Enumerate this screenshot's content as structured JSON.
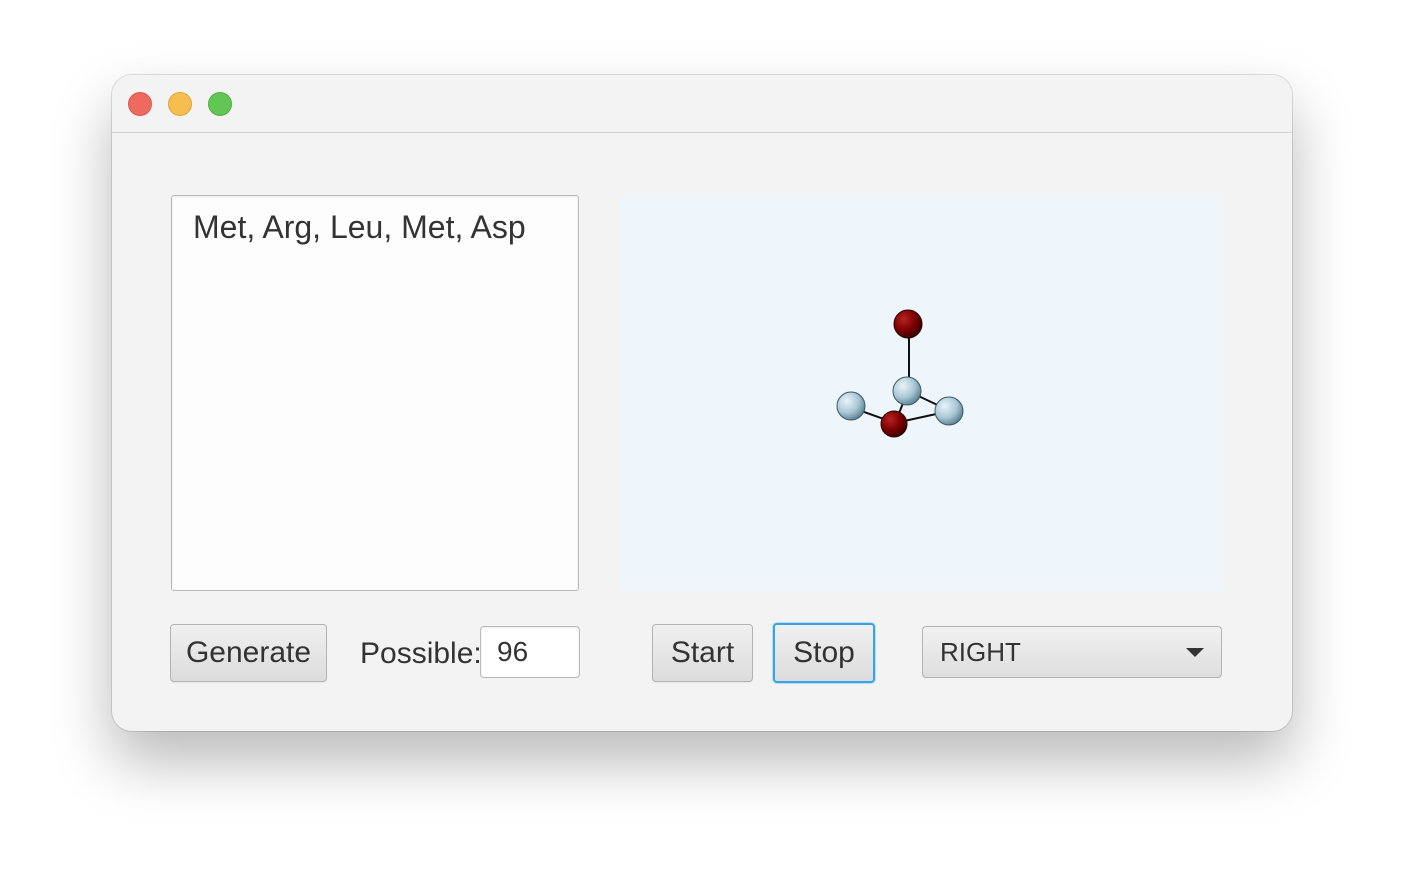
{
  "window": {
    "controls": [
      "close-button",
      "minimize-button",
      "zoom-button"
    ]
  },
  "sequence": {
    "text": "Met, Arg, Leu, Met, Asp"
  },
  "viewer": {
    "background": "#eef6fc",
    "atom_colors": {
      "dark_red": "#7a0000",
      "light_blue": "#a9c8d6"
    }
  },
  "controls": {
    "generate_label": "Generate",
    "possible_label": "Possible:",
    "possible_value": "96",
    "start_label": "Start",
    "stop_label": "Stop",
    "direction_value": "RIGHT"
  },
  "colors": {
    "focus_ring": "#3aa3e3",
    "window_bg": "#f3f3f3"
  }
}
